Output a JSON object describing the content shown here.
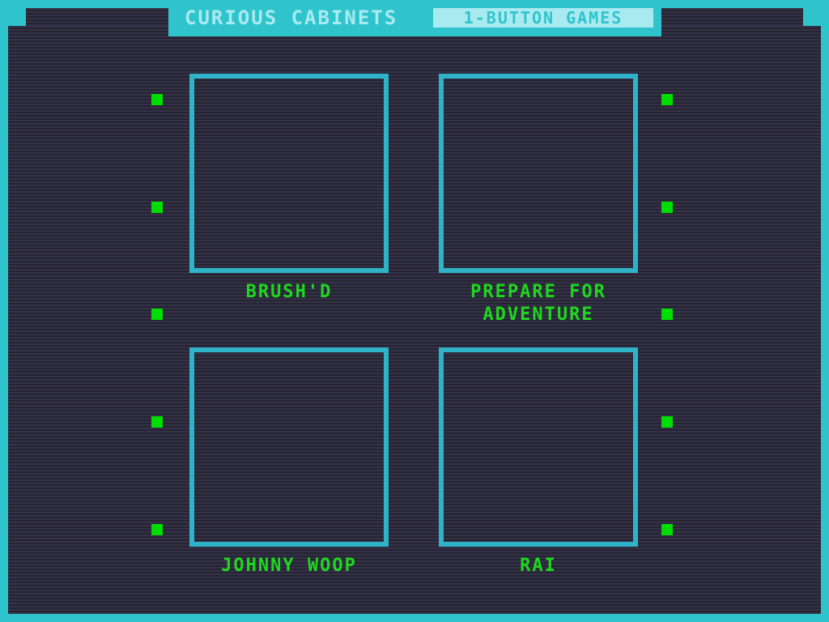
{
  "header": {
    "title": "CURIOUS CABINETS",
    "tab_label": "1-BUTTON GAMES"
  },
  "cabinets": [
    {
      "label": "BRUSH'D"
    },
    {
      "label": "PREPARE FOR\nADVENTURE"
    },
    {
      "label": "JOHNNY WOOP"
    },
    {
      "label": "RAI"
    }
  ],
  "colors": {
    "frame": "#2fc4cc",
    "header_text": "#a9eaf0",
    "cabinet_border": "#2fb3c8",
    "label_text": "#1ed81e",
    "indicator": "#00dd00",
    "background": "#2e2b3c"
  }
}
